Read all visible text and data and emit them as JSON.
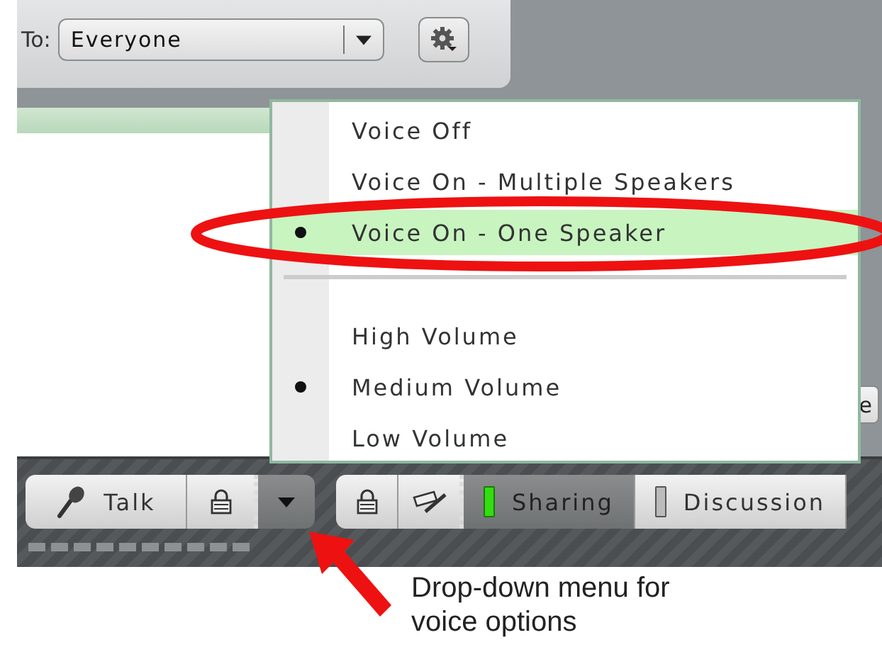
{
  "recipient": {
    "label": "To:",
    "value": "Everyone"
  },
  "voice_menu": {
    "groups": [
      {
        "items": [
          {
            "label": "Voice Off",
            "selected": false,
            "highlighted": false
          },
          {
            "label": "Voice On - Multiple Speakers",
            "selected": false,
            "highlighted": false
          },
          {
            "label": "Voice On - One Speaker",
            "selected": true,
            "highlighted": true
          }
        ]
      },
      {
        "items": [
          {
            "label": "High Volume",
            "selected": false,
            "highlighted": false
          },
          {
            "label": "Medium Volume",
            "selected": true,
            "highlighted": false
          },
          {
            "label": "Low Volume",
            "selected": false,
            "highlighted": false
          }
        ]
      }
    ]
  },
  "side_button": {
    "label": "e"
  },
  "toolbar": {
    "talk_button": {
      "label": "Talk"
    },
    "status_tabs": [
      {
        "label": "Sharing",
        "on": true
      },
      {
        "label": "Discussion",
        "on": false
      }
    ]
  },
  "caption": "Drop-down menu for voice options"
}
